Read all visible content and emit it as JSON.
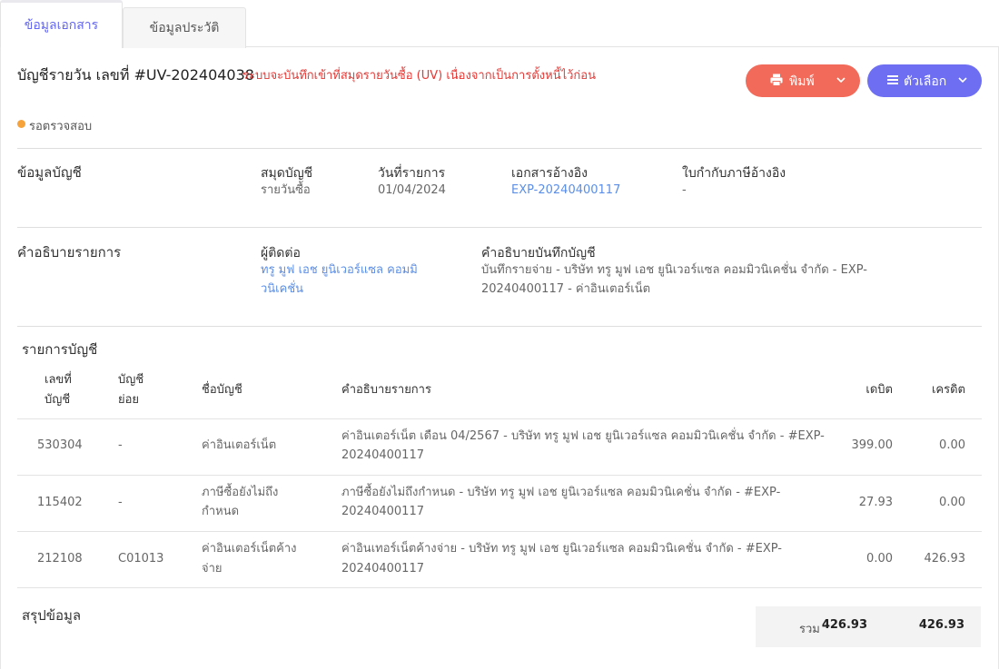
{
  "tabs": [
    {
      "label": "ข้อมูลเอกสาร",
      "active": true
    },
    {
      "label": "ข้อมูลประวัติ",
      "active": false
    }
  ],
  "header": {
    "title": "บัญชีรายวัน เลขที่ #UV-202404038",
    "warning": "ระบบจะบันทึกเข้าที่สมุดรายวันซื้อ (UV) เนื่องจากเป็นการตั้งหนี้ไว้ก่อน",
    "print_label": "พิมพ์",
    "options_label": "ตัวเลือก",
    "status": "รอตรวจสอบ"
  },
  "account_info": {
    "section_title": "ข้อมูลบัญชี",
    "book_label": "สมุดบัญชี",
    "book_value": "รายวันซื้อ",
    "date_label": "วันที่รายการ",
    "date_value": "01/04/2024",
    "ref_doc_label": "เอกสารอ้างอิง",
    "ref_doc_value": "EXP-20240400117",
    "tax_invoice_label": "ใบกำกับภาษีอ้างอิง",
    "tax_invoice_value": "-"
  },
  "description": {
    "section_title": "คำอธิบายรายการ",
    "contact_label": "ผู้ติดต่อ",
    "contact_line1": "ทรู มูฟ เอช ยูนิเวอร์แซล คอมมิ",
    "contact_line2": "วนิเคชั่น",
    "note_label": "คำอธิบายบันทึกบัญชี",
    "note_line1": "บันทึกรายจ่าย - บริษัท ทรู มูฟ เอช ยูนิเวอร์แซล คอมมิวนิเคชั่น จำกัด - EXP-",
    "note_line2": "20240400117 - ค่าอินเตอร์เน็ต"
  },
  "entries": {
    "section_title": "รายการบัญชี",
    "headers": {
      "account_no_1": "เลขที่",
      "account_no_2": "บัญชี",
      "sub_1": "บัญชี",
      "sub_2": "ย่อย",
      "name": "ชื่อบัญชี",
      "desc": "คำอธิบายรายการ",
      "debit": "เดบิต",
      "credit": "เครดิต"
    },
    "rows": [
      {
        "account_no": "530304",
        "sub": "-",
        "name_1": "ค่าอินเตอร์เน็ต",
        "name_2": "",
        "desc_1": "ค่าอินเตอร์เน็ต เดือน 04/2567 - บริษัท ทรู มูฟ เอช ยูนิเวอร์แซล คอมมิวนิเคชั่น จำกัด - #EXP-",
        "desc_2": "20240400117",
        "debit": "399.00",
        "credit": "0.00"
      },
      {
        "account_no": "115402",
        "sub": "-",
        "name_1": "ภาษีซื้อยังไม่ถึง",
        "name_2": "กำหนด",
        "desc_1": "ภาษีซื้อยังไม่ถึงกำหนด - บริษัท ทรู มูฟ เอช ยูนิเวอร์แซล คอมมิวนิเคชั่น จำกัด - #EXP-",
        "desc_2": "20240400117",
        "debit": "27.93",
        "credit": "0.00"
      },
      {
        "account_no": "212108",
        "sub": "C01013",
        "name_1": "ค่าอินเตอร์เน็ตค้าง",
        "name_2": "จ่าย",
        "desc_1": "ค่าอินเทอร์เน็ตค้างจ่าย - บริษัท ทรู มูฟ เอช ยูนิเวอร์แซล คอมมิวนิเคชั่น จำกัด - #EXP-",
        "desc_2": "20240400117",
        "debit": "0.00",
        "credit": "426.93"
      }
    ]
  },
  "summary": {
    "section_title": "สรุปข้อมูล",
    "total_label": "รวม",
    "total_debit": "426.93",
    "total_credit": "426.93"
  },
  "colors": {
    "accent": "#6366f1",
    "print_button": "#f26b5a",
    "options_button": "#6d6ef2",
    "warning": "#e53935",
    "link": "#5b8ee6",
    "status_pending": "#f5a33a"
  },
  "icons": {
    "print": "printer-icon",
    "options": "menu-lines-icon",
    "dropdown": "chevron-down-icon"
  }
}
